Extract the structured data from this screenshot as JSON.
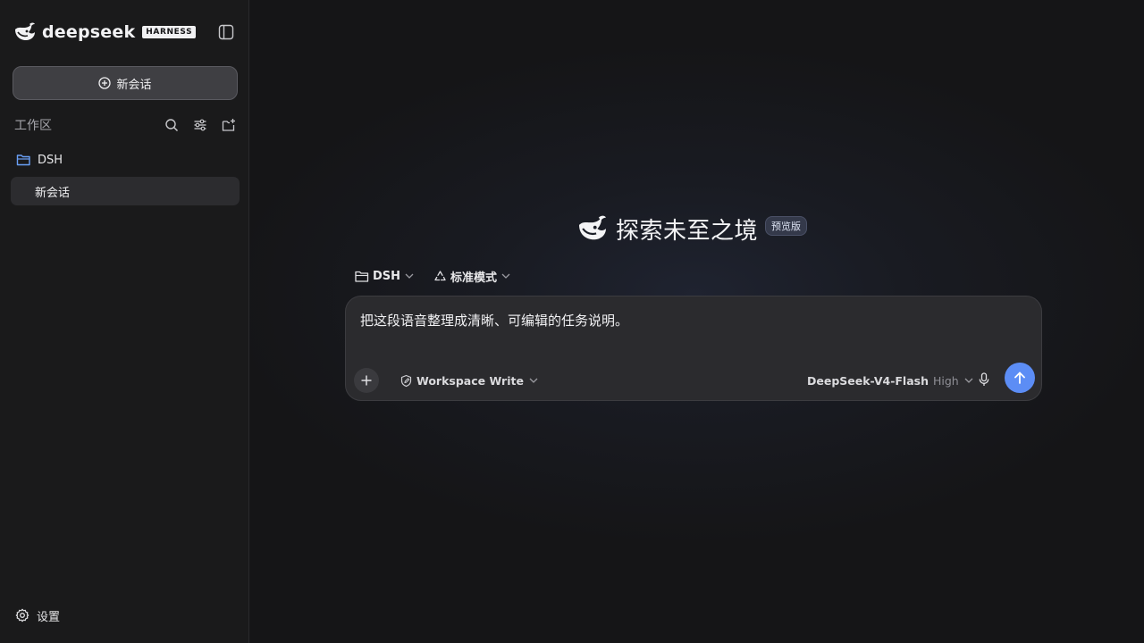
{
  "brand": {
    "name": "deepseek",
    "badge": "HARNESS",
    "logo_icon": "whale-logo-icon",
    "sidebar_toggle_icon": "sidebar-toggle-icon"
  },
  "sidebar": {
    "new_chat_label": "新会话",
    "workspace_title": "工作区",
    "tools": [
      "search-icon",
      "filter-sliders-icon",
      "new-folder-icon"
    ],
    "folder": {
      "name": "DSH",
      "icon": "folder-icon"
    },
    "chats": [
      {
        "label": "新会话",
        "selected": true
      }
    ],
    "settings_label": "设置"
  },
  "main": {
    "hero_title": "探索未至之境",
    "hero_badge": "预览版",
    "project_selector": "DSH",
    "mode_selector": "标准模式",
    "prompt_text": "把这段语音整理成清晰、可编辑的任务说明。",
    "permission": "Workspace Write",
    "model_name": "DeepSeek-V4-Flash",
    "model_level": "High"
  },
  "colors": {
    "accent": "#5c8df5",
    "folder_icon": "#6aa0f7",
    "sidebar_bg": "#1a1a1b",
    "main_bg": "#151517",
    "composer_bg": "#2b2b2e"
  }
}
